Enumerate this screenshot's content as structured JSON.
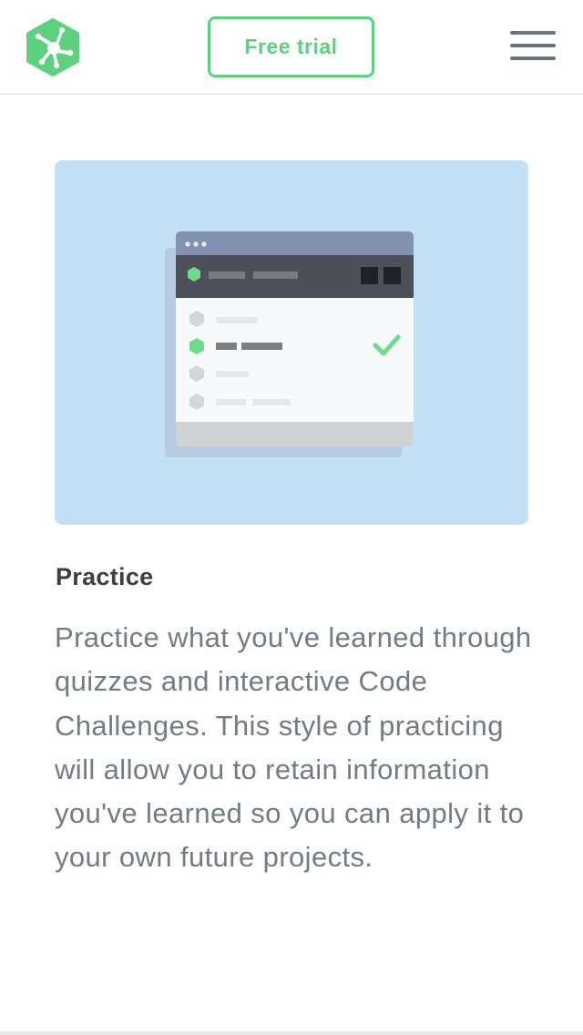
{
  "header": {
    "logo": "treehouse-frog-logo",
    "free_trial_label": "Free trial",
    "menu_icon": "hamburger-menu-icon"
  },
  "colors": {
    "accent_green": "#5fcf80",
    "hero_background": "#c3e0f5",
    "title_text": "#3a3f45",
    "body_text": "#737b83"
  },
  "feature": {
    "illustration": "code-challenge-window-illustration",
    "title": "Practice",
    "description": "Practice what you've learned through quizzes and interactive Code Challenges. This style of practicing will allow you to retain information you've learned so you can apply it to your own future projects."
  }
}
